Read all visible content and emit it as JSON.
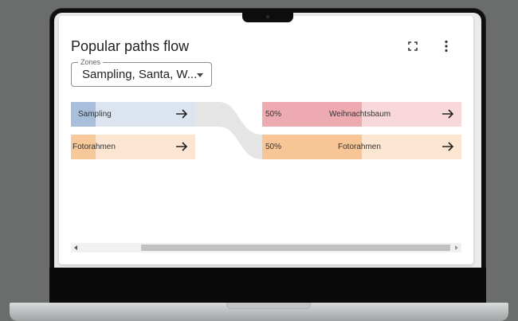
{
  "card": {
    "title": "Popular paths flow"
  },
  "zones": {
    "legend": "Zones",
    "value": "Sampling, Santa, W..."
  },
  "flow": {
    "left_nodes": [
      {
        "label": "Sampling",
        "color": "#dbe4ef",
        "strip": "#a9bedb"
      },
      {
        "label": "Fotorahmen",
        "color": "#fce6d2",
        "strip": "#f6c89a"
      }
    ],
    "right_nodes": [
      {
        "percent": "50%",
        "label": "Weihnachtsbaum",
        "color": "#f9d8dc",
        "strip": "#eeaab1"
      },
      {
        "percent": "50%",
        "label": "Fotorahmen",
        "color": "#fde6d1",
        "strip": "#f8c696"
      }
    ]
  },
  "icons": {
    "fullscreen": "fullscreen-icon",
    "more": "more-vert-icon",
    "arrow": "arrow-right-icon"
  }
}
